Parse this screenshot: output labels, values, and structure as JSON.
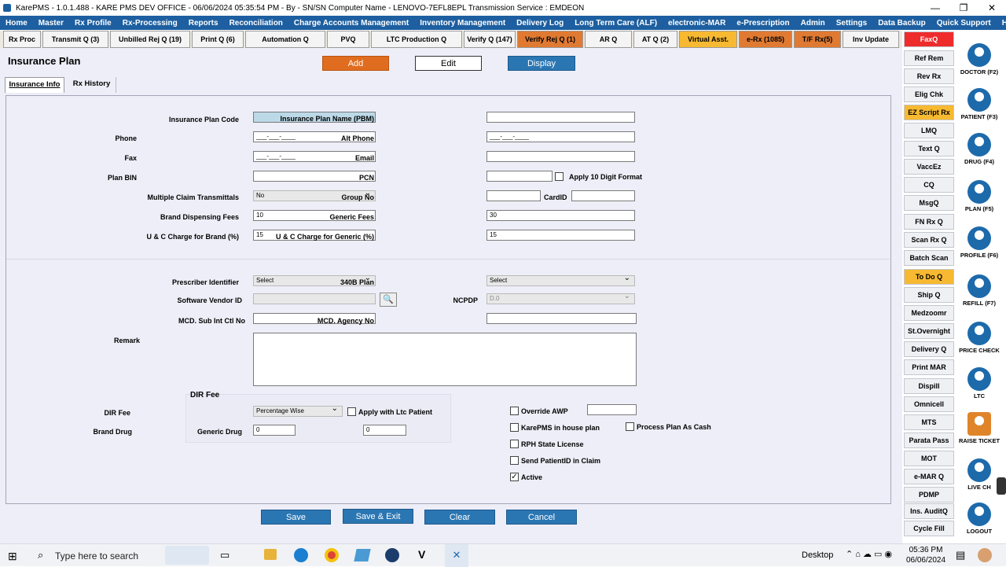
{
  "titlebar": {
    "title": "KarePMS - 1.0.1.488 - KARE PMS DEV OFFICE - 06/06/2024 05:35:54 PM - By - SN/SN  Computer Name - LENOVO-7EFL8EPL  Transmission Service : EMDEON"
  },
  "menu": [
    "Home",
    "Master",
    "Rx Profile",
    "Rx-Processing",
    "Reports",
    "Reconciliation",
    "Charge Accounts Management",
    "Inventory Management",
    "Delivery Log",
    "Long Term Care (ALF)",
    "electronic-MAR",
    "e-Prescription",
    "Admin",
    "Settings",
    "Data Backup",
    "Quick Support",
    "Help"
  ],
  "toolbar": [
    "Rx Proc",
    "Transmit Q (3)",
    "Unbilled Rej Q (19)",
    "Print Q (6)",
    "Automation Q",
    "PVQ",
    "LTC Production Q",
    "Verify Q (147)",
    "Verify Rej Q (1)",
    "AR Q",
    "AT Q (2)",
    "Virtual Asst.",
    "e-Rx (1085)",
    "T/F Rx(5)",
    "Inv Update"
  ],
  "page": {
    "title": "Insurance Plan",
    "add": "Add",
    "edit": "Edit",
    "display": "Display",
    "tab1": "Insurance Info",
    "tab2": "Rx History"
  },
  "form": {
    "plan_code": "Insurance Plan Code",
    "plan_name": "Insurance Plan Name (PBM)",
    "phone": "Phone",
    "phone_val": "___-___-____",
    "alt_phone": "Alt Phone",
    "alt_phone_val": "___-___-____",
    "fax": "Fax",
    "fax_val": "___-___-____",
    "email": "Email",
    "bin": "Plan BIN",
    "pcn": "PCN",
    "apply10": "Apply 10 Digit Format",
    "mct": "Multiple Claim Transmittals",
    "mct_val": "No",
    "group": "Group No",
    "cardid": "CardID",
    "brand_fee": "Brand Dispensing Fees",
    "brand_fee_val": "10",
    "generic_fee": "Generic Fees",
    "generic_fee_val": "30",
    "uc_brand": "U & C Charge for Brand (%)",
    "uc_brand_val": "15",
    "uc_generic": "U & C Charge for Generic (%)",
    "uc_generic_val": "15",
    "prescriber": "Prescriber Identifier",
    "prescriber_val": "Select",
    "p340b": "340B Plan",
    "p340b_val": "Select",
    "vendor": "Software Vendor ID",
    "ncpdp": "NCPDP",
    "ncpdp_val": "D.0",
    "mcd_sub": "MCD. Sub Int Ctl No",
    "mcd_agency": "MCD. Agency No",
    "remark": "Remark",
    "dir_title": "DIR Fee",
    "dir_fee": "DIR Fee",
    "dir_val": "Percentage Wise",
    "apply_ltc": "Apply with Ltc Patient",
    "brand_drug": "Brand Drug",
    "brand_drug_val": "0",
    "generic_drug": "Generic Drug",
    "generic_drug_val": "0",
    "override_awp": "Override AWP",
    "inhouse": "KarePMS in house plan",
    "process_cash": "Process Plan As Cash",
    "rph": "RPH State License",
    "send_pid": "Send PatientID in Claim",
    "active": "Active"
  },
  "buttons": {
    "save": "Save",
    "save_exit": "Save & Exit",
    "clear": "Clear",
    "cancel": "Cancel"
  },
  "rightbuttons": [
    "FaxQ",
    "Ref Rem",
    "Rev Rx",
    "Elig Chk",
    "EZ Script Rx",
    "LMQ",
    "Text Q",
    "VaccEz",
    "CQ",
    "MsgQ",
    "FN Rx Q",
    "Scan Rx Q",
    "Batch Scan",
    "To Do Q",
    "Ship Q",
    "Medzoomr",
    "St.Overnight",
    "Delivery Q",
    "Print MAR",
    "Dispill",
    "Omnicell",
    "MTS",
    "Parata Pass",
    "MOT",
    "e-MAR Q",
    "PDMP",
    "Ins. AuditQ",
    "Cycle Fill"
  ],
  "iconbuttons": [
    "DOCTOR (F2)",
    "PATIENT (F3)",
    "DRUG (F4)",
    "PLAN (F5)",
    "PROFILE (F6)",
    "REFILL (F7)",
    "PRICE CHECK",
    "LTC",
    "RAISE TICKET",
    "LIVE CH",
    "LOGOUT"
  ],
  "taskbar": {
    "search": "Type here to search",
    "desktop": "Desktop",
    "time": "05:36 PM",
    "date": "06/06/2024"
  }
}
